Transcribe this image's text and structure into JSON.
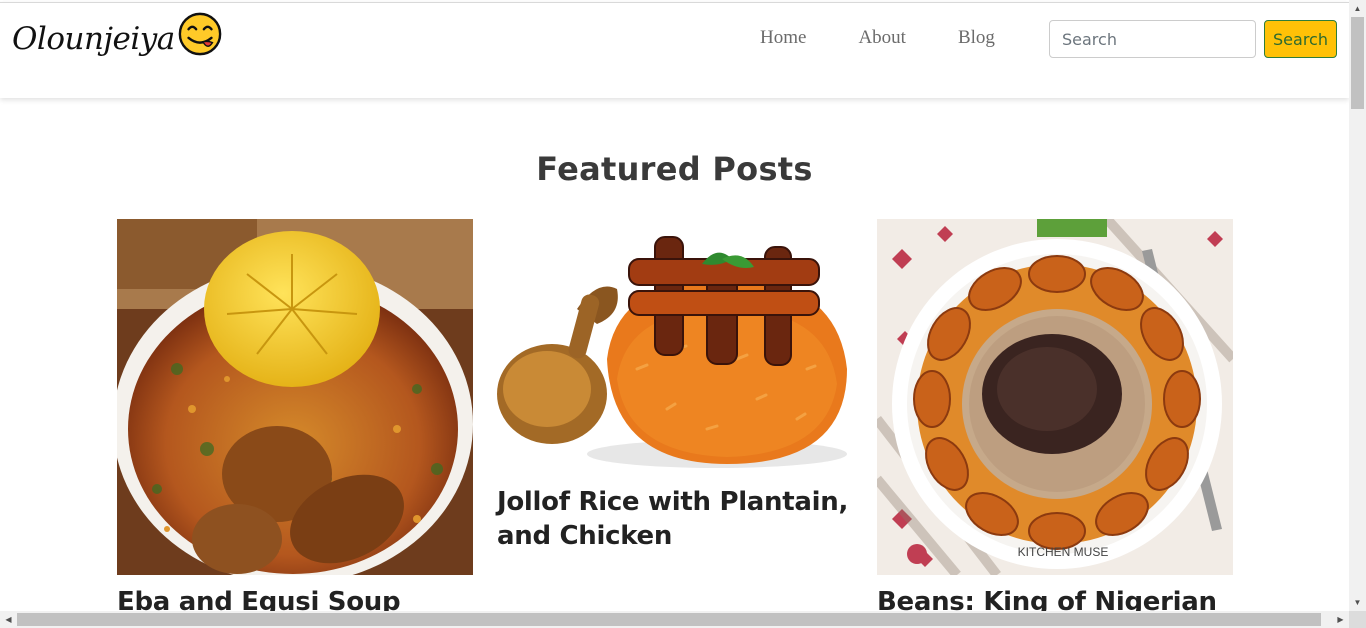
{
  "navbar": {
    "brand": "Olounjeiya",
    "brand_emoji_icon": "yum-face-emoji-icon",
    "links": [
      "Home",
      "About",
      "Blog"
    ],
    "search_placeholder": "Search",
    "search_button": "Search"
  },
  "featured": {
    "title": "Featured Posts",
    "posts": [
      {
        "title": "Eba and Egusi Soup",
        "image_icon": "eba-egusi-photo"
      },
      {
        "title": "Jollof Rice with Plantain, and Chicken",
        "image_icon": "jollof-rice-photo"
      },
      {
        "title": "Beans: King of Nigerian",
        "image_icon": "beans-plantain-photo",
        "image_watermark": "KITCHEN MUSE"
      }
    ]
  },
  "colors": {
    "search_button_bg": "#ffc107",
    "search_button_border": "#2f7d3a",
    "nav_link": "#6b6b6b",
    "heading": "#3a3a3a"
  }
}
